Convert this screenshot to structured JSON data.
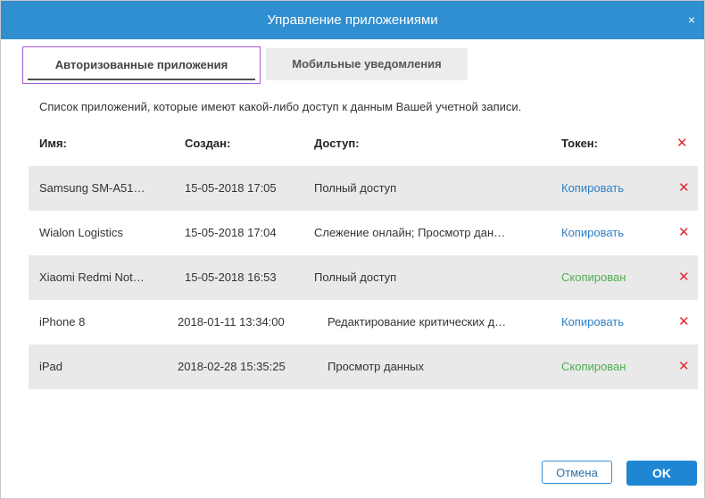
{
  "dialog": {
    "title": "Управление приложениями",
    "close_glyph": "×",
    "close_icon": "close-icon"
  },
  "tabs": [
    {
      "label": "Авторизованные приложения",
      "active": true
    },
    {
      "label": "Мобильные уведомления",
      "active": false
    }
  ],
  "description": "Список приложений, которые имеют какой-либо доступ к данным Вашей учетной записи.",
  "table": {
    "headers": {
      "name": "Имя:",
      "created": "Создан:",
      "access": "Доступ:",
      "token": "Токен:"
    },
    "delete_glyph": "✕",
    "delete_icon": "delete-x-icon",
    "rows": [
      {
        "name": "Samsung SM-A51…",
        "created": "15-05-2018 17:05",
        "access": "Полный доступ",
        "token": "Копировать",
        "token_state": "copy"
      },
      {
        "name": "Wialon Logistics",
        "created": "15-05-2018 17:04",
        "access": "Слежение онлайн; Просмотр дан…",
        "token": "Копировать",
        "token_state": "copy"
      },
      {
        "name": "Xiaomi Redmi Not…",
        "created": "15-05-2018 16:53",
        "access": "Полный доступ",
        "token": "Скопирован",
        "token_state": "copied"
      },
      {
        "name": "iPhone 8",
        "created": "2018-01-11 13:34:00",
        "access": "Редактирование критических д…",
        "token": "Копировать",
        "token_state": "copy"
      },
      {
        "name": "iPad",
        "created": "2018-02-28 15:35:25",
        "access": "Просмотр данных",
        "token": "Скопирован",
        "token_state": "copied"
      }
    ]
  },
  "buttons": {
    "cancel": "Отмена",
    "ok": "OK"
  },
  "colors": {
    "titlebar": "#2f8fd1",
    "link_copy": "#2f7fc6",
    "link_copied": "#4caf50",
    "delete": "#e0282e",
    "tab_highlight": "#a45ad6"
  }
}
